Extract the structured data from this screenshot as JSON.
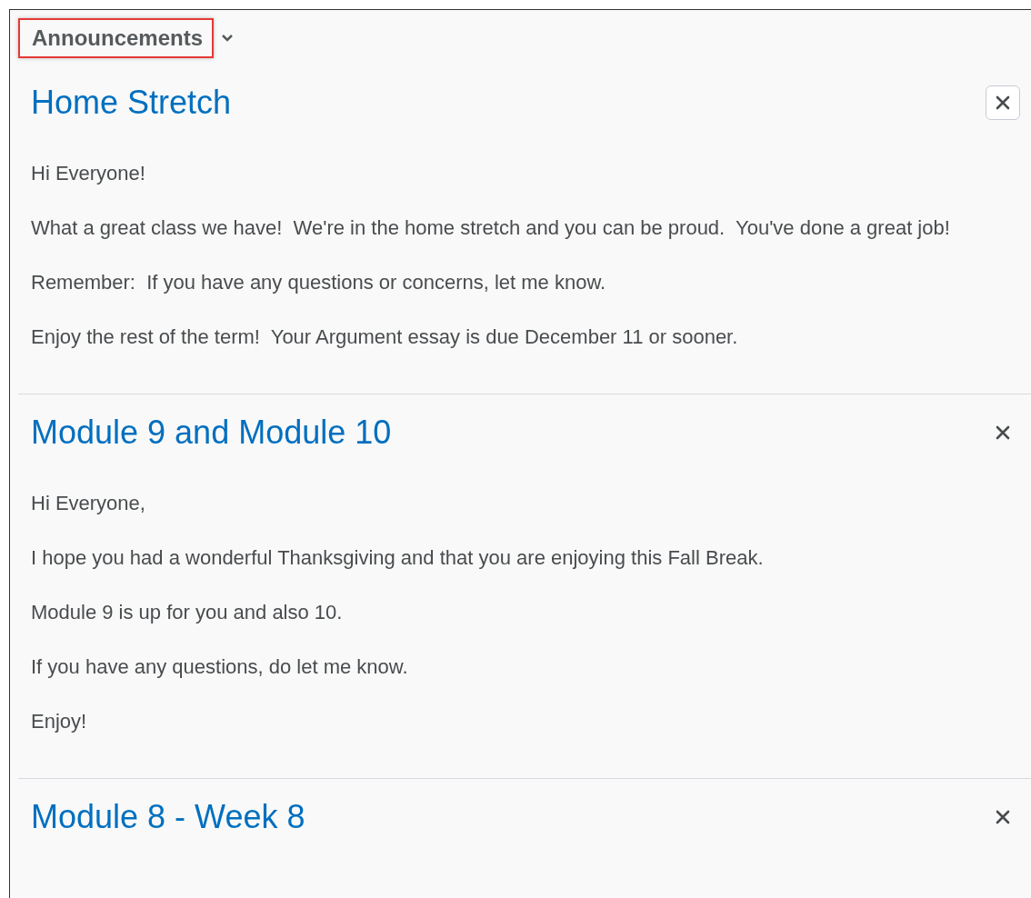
{
  "header": {
    "title": "Announcements",
    "highlighted": true
  },
  "announcements": [
    {
      "title": "Home Stretch",
      "close_focused": true,
      "paragraphs": [
        "Hi Everyone!",
        "What a great class we have!  We're in the home stretch and you can be proud.  You've done a great job!",
        "Remember:  If you have any questions or concerns, let me know.",
        "Enjoy the rest of the term!  Your Argument essay is due December 11 or sooner."
      ]
    },
    {
      "title": "Module 9 and Module 10",
      "close_focused": false,
      "paragraphs": [
        "Hi Everyone,",
        "I hope you had a wonderful Thanksgiving and that you are enjoying this Fall Break.",
        "Module 9 is up for you and also 10.",
        "If you have any questions, do let me know.",
        "Enjoy!"
      ]
    },
    {
      "title": "Module 8 - Week 8",
      "close_focused": false
    }
  ]
}
